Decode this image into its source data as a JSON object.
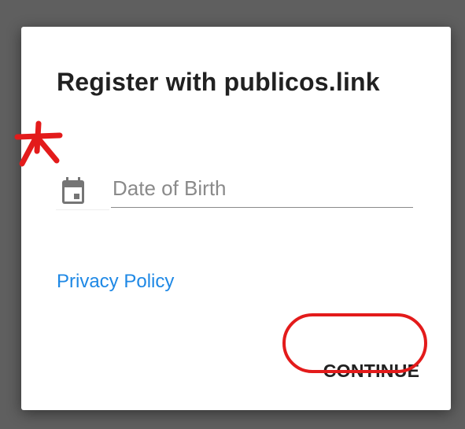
{
  "dialog": {
    "title": "Register with publicos.link",
    "date_field": {
      "placeholder": "Date of Birth",
      "value": "",
      "icon": "calendar-icon"
    },
    "privacy_link": "Privacy Policy",
    "continue_label": "CONTINUE"
  },
  "annotations": {
    "required_marker_color": "#e31b1b",
    "highlight_circle_color": "#e31b1b"
  },
  "colors": {
    "backdrop": "#5f5f5f",
    "link": "#1e88e5",
    "title": "#212121"
  }
}
